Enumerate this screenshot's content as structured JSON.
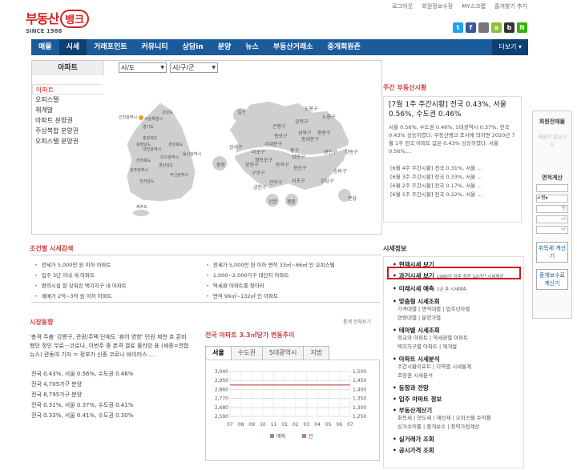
{
  "header": {
    "logo": {
      "main": "부동산",
      "badge": "뱅크",
      "since": "SINCE 1988"
    },
    "top_links": [
      "로그아웃",
      "회원정보수정",
      "MY스크랩",
      "즐겨찾기 추가"
    ],
    "social": [
      {
        "name": "twitter",
        "color": "#1da1f2",
        "glyph": "t"
      },
      {
        "name": "facebook",
        "color": "#3b5998",
        "glyph": "f"
      },
      {
        "name": "apple",
        "color": "#777777",
        "glyph": ""
      },
      {
        "name": "android",
        "color": "#8bbf3f",
        "glyph": "a"
      },
      {
        "name": "blog",
        "color": "#333333",
        "glyph": "b"
      },
      {
        "name": "naver",
        "color": "#2db400",
        "glyph": "N"
      }
    ]
  },
  "nav": {
    "items": [
      "매물",
      "시세",
      "거래포인트",
      "커뮤니티",
      "상담in",
      "분양",
      "뉴스",
      "부동산거래소",
      "중개회원존"
    ],
    "active_index": 1,
    "more": "더보기 ▾"
  },
  "search": {
    "category": "아파트",
    "sido": "시/도",
    "gugun": "시/구/군"
  },
  "leftmenu": [
    "아파트",
    "오피스텔",
    "재개발",
    "아파트 분양권",
    "주상복합 분양권",
    "오피스텔 분양권"
  ],
  "maps": {
    "korea": [
      "강원도",
      "인천광역시",
      "서울특별시",
      "경기도",
      "충청북도",
      "충청남도",
      "대전광역시",
      "경상북도",
      "대구광역시",
      "전라북도",
      "울산광역시",
      "광주광역시",
      "경상남도",
      "부산광역시",
      "전라남도",
      "제주도"
    ],
    "seoul": [
      "도봉구",
      "노원구",
      "강북구",
      "은평구",
      "성북구",
      "중랑구",
      "종로구",
      "동대문구",
      "서대문구",
      "마포구",
      "중구",
      "성동구",
      "광진구",
      "강동구",
      "강서구",
      "양천구",
      "영등포구",
      "동작구",
      "용산구",
      "송파구",
      "구로구",
      "금천구",
      "관악구",
      "서초구",
      "강남구",
      "일산",
      "중동",
      "분당",
      "산본",
      "평촌"
    ]
  },
  "weekly": {
    "heading": "주간 부동산시황",
    "title": "[7월 1주 주간시황] 전국 0.43%, 서울 0.56%, 수도권 0.46%",
    "summary": "서울 0.56%, 수도권 0.46%, 5대광역시 0.37%, 전국 0.43% 상승하였다. 부동산뱅크 조사에 의하면 2020년 7월 1주 전국 아파트 값은 0.43% 상승하였다. 서울 0.56%....",
    "list": [
      "[6월 4주 주간시황] 전국 0.31%, 서울 ...",
      "[6월 3주 주간시황] 전국 0.33%, 서울 ...",
      "[6월 2주 주간시황] 전국 0.17%, 서울 ...",
      "[6월 1주 주간시황] 전국 0.22%, 서울 ..."
    ]
  },
  "conditions": {
    "title": "조건별 시세검색",
    "left": [
      "전세가 5,000만 원 이하 아파트",
      "입주 3년 이내 새 아파트",
      "편의시설 잘 갖춰진 택지지구 내 아파트",
      "매매가 2억~3억 원 이하 아파트"
    ],
    "right": [
      "전세가 5,000만 원 이하 면적 33㎡~66㎡ 인 오피스텔",
      "1,000~2,000가구 대단지 아파트",
      "역세권 아파트를 찾아라",
      "면적 99㎡~132㎡ 인 아파트"
    ]
  },
  "trend": {
    "title": "시장동향",
    "text": "'충격 주춤' 강릉구, 관광/주택 단체도 '휴어 영향' 민원 제천 흐 흔비했던 정인 무료···코로나, 이번주 중 본격 결료 플라잉 표 (세종=연합뉴스) 관동여 기자 = 정부가 신종 코로나 바이러스 ...",
    "list": [
      "전국 0.43%, 서울 0.56%, 수도권 0.46%",
      "전국 4,705가구 분양",
      "전국 8,795가구 분양",
      "전국 0.31%, 서울 0.37%, 수도권 0.41%",
      "전국 0.33%, 서울 0.41%, 수도권 0.30%"
    ]
  },
  "chart_tabs": [
    "서울",
    "수도권",
    "5대광역시",
    "지방"
  ],
  "chart_link": "통계 전체보기",
  "chart_data": {
    "type": "line",
    "title": "전국 아파트 3.3㎡당가 변동추이",
    "categories": [
      "07",
      "08",
      "09",
      "10",
      "11",
      "01",
      "02",
      "03",
      "04",
      "05",
      "06",
      "07"
    ],
    "y_left": {
      "ticks": [
        "3,040",
        "2,950",
        "2,860",
        "2,770",
        "2,680",
        "2,590"
      ],
      "ylim": [
        2590,
        3040
      ]
    },
    "y_right": {
      "ticks": [
        "1,500",
        "1,450",
        "1,400",
        "1,350",
        "1,300",
        "1,250"
      ],
      "ylim": [
        1250,
        1500
      ]
    },
    "series": [
      {
        "name": "매매",
        "color": "#7a8fc6",
        "axis": "left",
        "values": [
          2905,
          2905,
          2905,
          2905,
          2905,
          2905,
          2905,
          2905,
          2905,
          2905,
          2905,
          2905
        ]
      },
      {
        "name": "전",
        "color": "#c87878",
        "axis": "right",
        "values": [
          1425,
          1425,
          1425,
          1425,
          1425,
          1425,
          1425,
          1425,
          1425,
          1425,
          1425,
          1425
        ]
      }
    ],
    "grid": true,
    "legend": "bottom"
  },
  "market": {
    "title": "시세정보",
    "sections": [
      {
        "head": "현재시세 보기",
        "items": []
      },
      {
        "head": "과거시세 보기",
        "note": "1988년 이후 최장 32년간 시세제공",
        "items": []
      },
      {
        "head": "미래시세 예측",
        "note": "1년 후 시세예측",
        "items": []
      },
      {
        "head": "맞춤형 시세조회",
        "items": [
          "가격대별 | 면적대별 | 입주년차별",
          "연령대별 | 분양가별"
        ]
      },
      {
        "head": "테마별 시세조회",
        "items": [
          "학교와 아파트 | 역세권별 아파트",
          "택지지구별 아파트 | 재개발"
        ]
      },
      {
        "head": "아파트 시세분석",
        "items": [
          "주간시황리포트 | 지역별 시세통계",
          "조망권 시세분석"
        ]
      },
      {
        "head": "동향과 전망",
        "items": []
      },
      {
        "head": "입주 아파트 정보",
        "items": []
      },
      {
        "head": "부동산계산기",
        "items": [
          "취득세 | 양도세 | 재산세 | 오피스텔 수익률",
          "상가수익률 | 중개보수 | 청약가점계산"
        ]
      },
      {
        "head": "실거래가 조회",
        "items": []
      },
      {
        "head": "공시가격 조회",
        "items": []
      }
    ]
  },
  "side": {
    "title": "회원전매물",
    "empty": "매물이 없습니다",
    "calc_title": "면적계산",
    "unit1": "평",
    "unit2": "㎡",
    "btn1": "취득세 계산기",
    "btn2": "중개보수료 계산기"
  }
}
